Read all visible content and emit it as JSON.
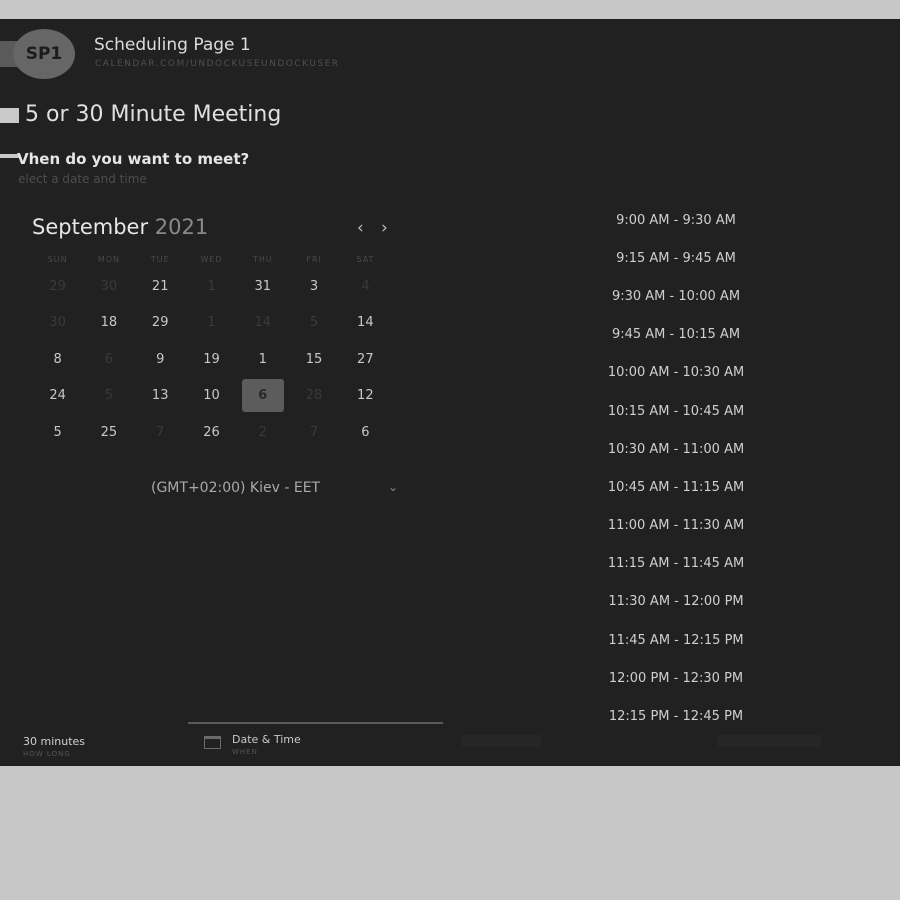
{
  "header": {
    "avatar_initials": "SP1",
    "title": "Scheduling Page 1",
    "url": "CALENDAR.COM/UNDOCKUSEUNDOCKUSER"
  },
  "meeting": {
    "title": "5 or 30 Minute Meeting",
    "question": "Vhen do you want to meet?",
    "hint": "elect a date and time"
  },
  "calendar": {
    "month": "September",
    "year": "2021",
    "prev_icon": "chevron-left-icon",
    "next_icon": "chevron-right-icon",
    "weekdays": [
      "SUN",
      "MON",
      "TUE",
      "WED",
      "THU",
      "FRI",
      "SAT"
    ],
    "weeks": [
      [
        {
          "d": "29",
          "dim": true
        },
        {
          "d": "30",
          "dim": true
        },
        {
          "d": "21",
          "dim": false
        },
        {
          "d": "1",
          "dim": true
        },
        {
          "d": "31",
          "dim": false
        },
        {
          "d": "3",
          "dim": false
        },
        {
          "d": "4",
          "dim": true
        }
      ],
      [
        {
          "d": "30",
          "dim": true
        },
        {
          "d": "18",
          "dim": false
        },
        {
          "d": "29",
          "dim": false
        },
        {
          "d": "1",
          "dim": true
        },
        {
          "d": "14",
          "dim": true
        },
        {
          "d": "5",
          "dim": true
        },
        {
          "d": "14",
          "dim": false
        }
      ],
      [
        {
          "d": "8",
          "dim": false
        },
        {
          "d": "6",
          "dim": true
        },
        {
          "d": "9",
          "dim": false
        },
        {
          "d": "19",
          "dim": false
        },
        {
          "d": "1",
          "dim": false
        },
        {
          "d": "15",
          "dim": false
        },
        {
          "d": "27",
          "dim": false
        }
      ],
      [
        {
          "d": "24",
          "dim": false
        },
        {
          "d": "5",
          "dim": true
        },
        {
          "d": "13",
          "dim": false
        },
        {
          "d": "10",
          "dim": false
        },
        {
          "d": "6",
          "dim": false,
          "selected": true
        },
        {
          "d": "28",
          "dim": true
        },
        {
          "d": "12",
          "dim": false
        }
      ],
      [
        {
          "d": "5",
          "dim": false
        },
        {
          "d": "25",
          "dim": false
        },
        {
          "d": "7",
          "dim": true
        },
        {
          "d": "26",
          "dim": false
        },
        {
          "d": "2",
          "dim": true
        },
        {
          "d": "7",
          "dim": true
        },
        {
          "d": "6",
          "dim": false
        }
      ]
    ]
  },
  "timezone": {
    "label": "(GMT+02:00) Kiev - EET",
    "chevron": "⌄"
  },
  "time_slots": [
    "9:00 AM - 9:30 AM",
    "9:15 AM - 9:45 AM",
    "9:30 AM - 10:00 AM",
    "9:45 AM - 10:15 AM",
    "10:00 AM - 10:30 AM",
    "10:15 AM - 10:45 AM",
    "10:30 AM - 11:00 AM",
    "10:45 AM - 11:15 AM",
    "11:00 AM - 11:30 AM",
    "11:15 AM - 11:45 AM",
    "11:30 AM - 12:00 PM",
    "11:45 AM - 12:15 PM",
    "12:00 PM - 12:30 PM",
    "12:15 PM - 12:45 PM"
  ],
  "footer": {
    "duration": "30 minutes",
    "duration_sub": "HOW LONG",
    "date_time": "Date & Time",
    "date_time_sub": "WHEN"
  },
  "colors": {
    "background": "#212121",
    "frame": "#c7c7c7",
    "selected_day": "#5c5c5c"
  }
}
